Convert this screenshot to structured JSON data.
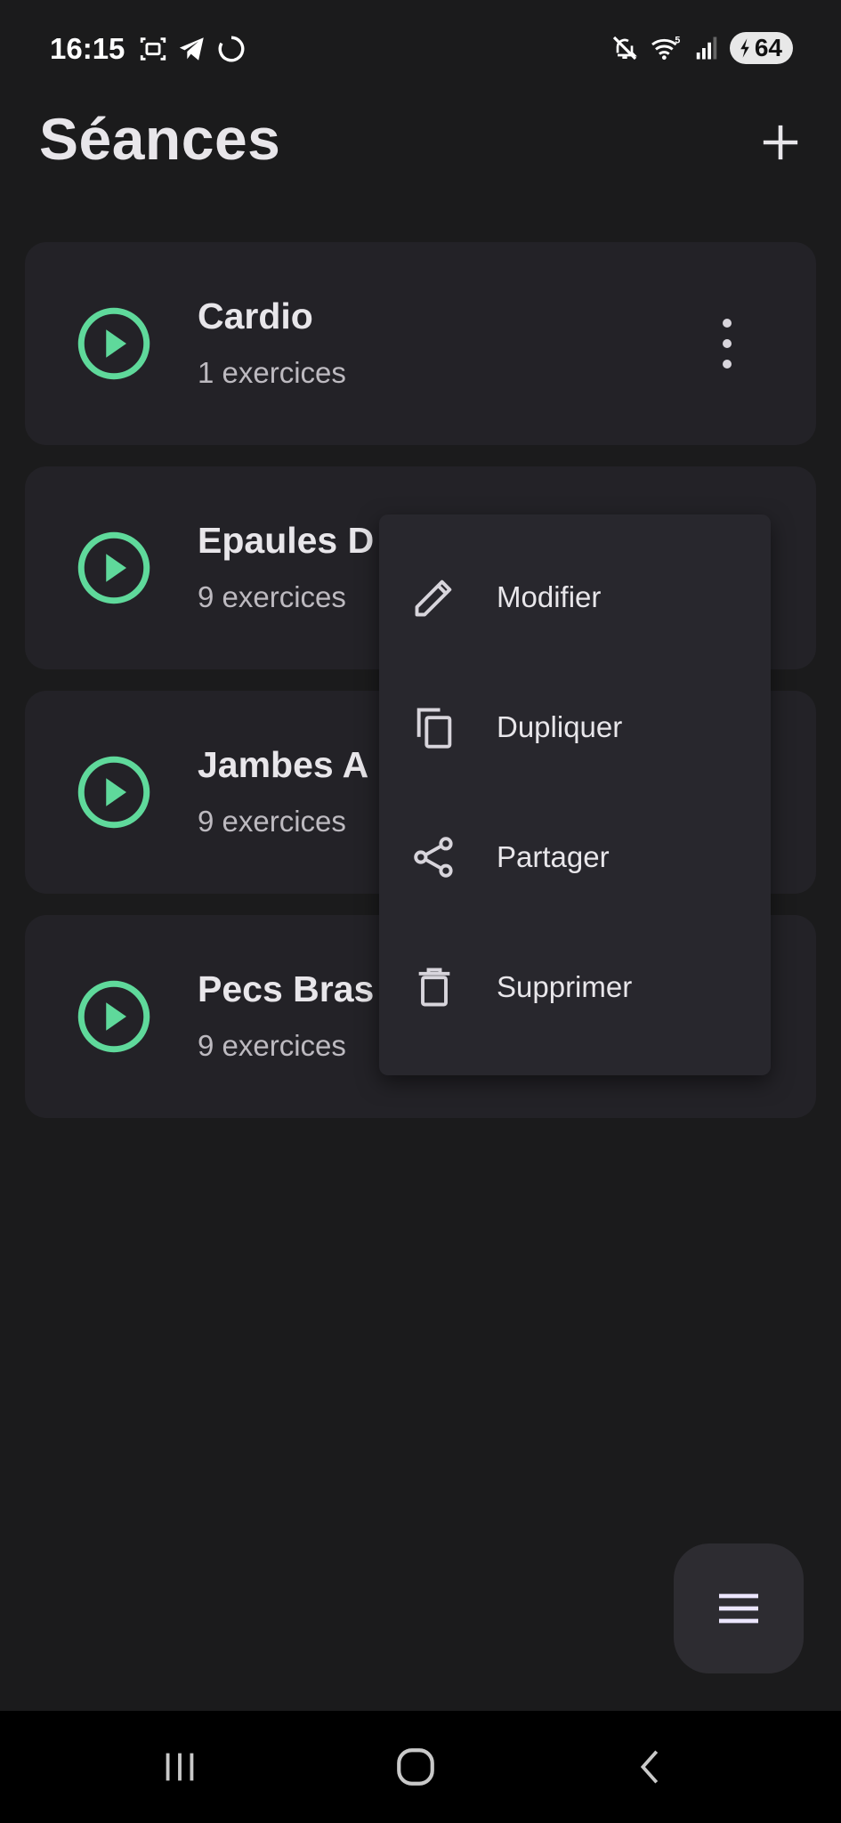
{
  "status_bar": {
    "time": "16:15",
    "battery": "64",
    "icons": [
      "screenshot-icon",
      "telegram-icon",
      "loading-circle-icon",
      "mute-icon",
      "wifi-icon",
      "signal-icon",
      "battery-charging-icon"
    ]
  },
  "header": {
    "title": "Séances",
    "add_icon": "plus-icon"
  },
  "sessions": [
    {
      "name": "Cardio",
      "count": "1 exercices"
    },
    {
      "name": "Epaules D",
      "count": "9 exercices"
    },
    {
      "name": "Jambes A",
      "count": "9 exercices"
    },
    {
      "name": "Pecs Bras",
      "count": "9 exercices"
    }
  ],
  "context_menu": {
    "items": [
      {
        "label": "Modifier",
        "icon": "pencil-icon"
      },
      {
        "label": "Dupliquer",
        "icon": "copy-icon"
      },
      {
        "label": "Partager",
        "icon": "share-icon"
      },
      {
        "label": "Supprimer",
        "icon": "trash-icon"
      }
    ]
  },
  "fab": {
    "icon": "menu-icon"
  },
  "colors": {
    "background": "#1b1b1c",
    "card": "#232227",
    "accent": "#5fd99b",
    "menu": "#28272d"
  }
}
